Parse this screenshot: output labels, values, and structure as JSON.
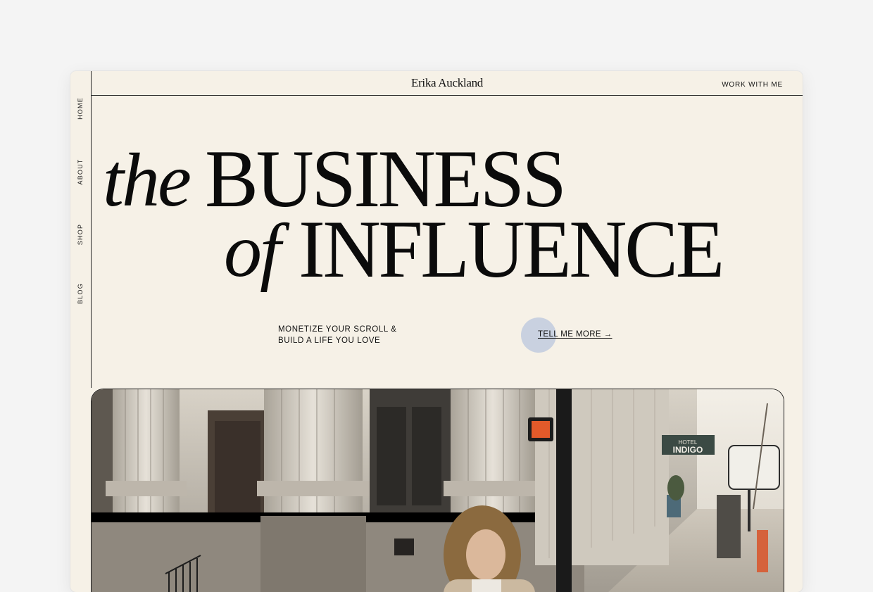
{
  "side_nav": {
    "items": [
      {
        "label": "HOME"
      },
      {
        "label": "ABOUT"
      },
      {
        "label": "SHOP"
      },
      {
        "label": "BLOG"
      }
    ]
  },
  "header": {
    "brand": "Erika Auckland",
    "work_link": "WORK WITH ME"
  },
  "hero": {
    "line1_italic": "the",
    "line1_caps": "BUSINESS",
    "line2_italic": "of",
    "line2_caps": "INFLUENCE",
    "tagline_line1": "MONETIZE YOUR SCROLL &",
    "tagline_line2": "BUILD A LIFE YOU LOVE",
    "cta_label": "TELL ME MORE →"
  },
  "photo": {
    "hotel_sign": "INDIGO",
    "hotel_sign_top": "HOTEL"
  },
  "colors": {
    "page_bg": "#f4f4f4",
    "panel_bg": "#f6f1e7",
    "ink": "#0b0b0b",
    "cta_dot": "#c9d1e0"
  }
}
